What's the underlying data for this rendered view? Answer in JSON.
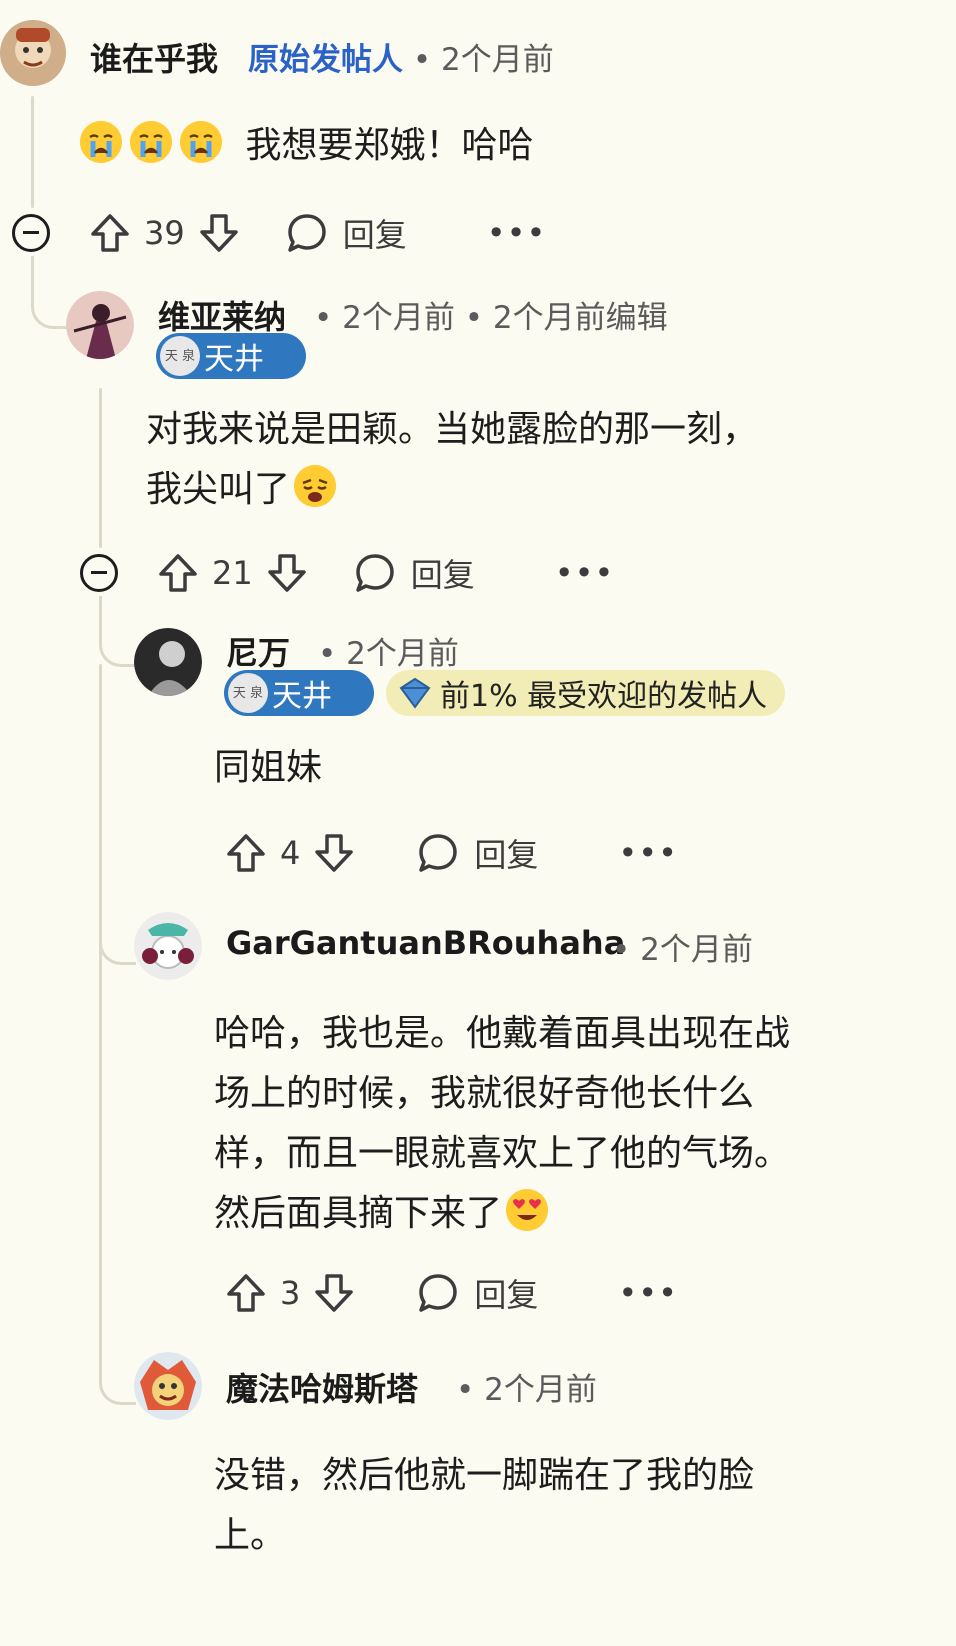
{
  "comments": [
    {
      "username": "谁在乎我",
      "op_label": "原始发帖人",
      "time": "2个月前",
      "text": "我想要郑娥！哈哈",
      "votes": "39",
      "reply_label": "回复"
    },
    {
      "username": "维亚莱纳",
      "time": "2个月前",
      "edited": "2个月前编辑",
      "flair": "天井",
      "text_line1": "对我来说是田颖。当她露脸的那一刻，",
      "text_line2": "我尖叫了",
      "votes": "21",
      "reply_label": "回复"
    },
    {
      "username": "尼万",
      "time": "2个月前",
      "flair": "天井",
      "badge": "前1% 最受欢迎的发帖人",
      "text": "同姐妹",
      "votes": "4",
      "reply_label": "回复"
    },
    {
      "username": "GarGantuanBRouhaha",
      "time": "2个月前",
      "text_line1": "哈哈，我也是。他戴着面具出现在战",
      "text_line2": "场上的时候，我就很好奇他长什么",
      "text_line3": "样，而且一眼就喜欢上了他的气场。",
      "text_line4": "然后面具摘下来了",
      "votes": "3",
      "reply_label": "回复"
    },
    {
      "username": "魔法哈姆斯塔",
      "time": "2个月前",
      "text_line1": "没错，然后他就一脚踹在了我的脸",
      "text_line2": "上。"
    }
  ],
  "flair_medal_text": "天 泉",
  "icons": {
    "upvote": "upvote-arrow-icon",
    "downvote": "downvote-arrow-icon",
    "reply": "speech-bubble-icon",
    "more": "more-dots-icon",
    "collapse": "collapse-minus-icon"
  },
  "colors": {
    "background": "#fcfbf2",
    "op_label": "#2a62c7",
    "flair": "#2f78c0",
    "badge": "#f2edb6",
    "thread_line": "#ddd9c8"
  }
}
